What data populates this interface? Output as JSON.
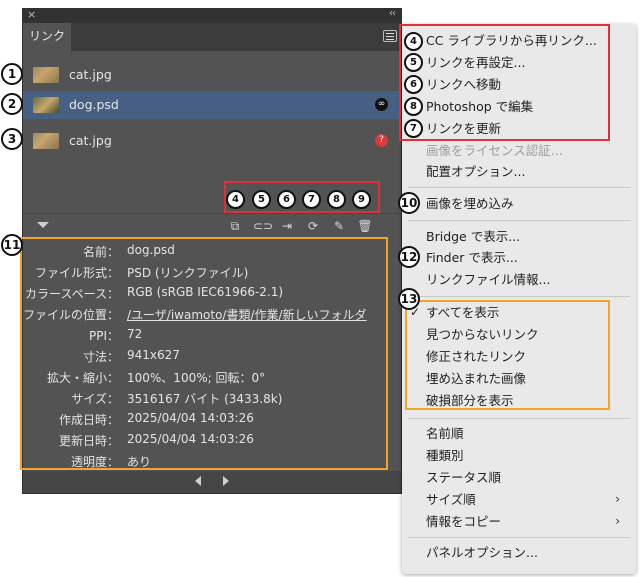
{
  "panel": {
    "close_icon": "×",
    "collapse_icon": "‹‹",
    "tab_label": "リンク",
    "links": [
      {
        "name": "cat.jpg",
        "thumb": "cat",
        "badge": ""
      },
      {
        "name": "dog.psd",
        "thumb": "dog",
        "badge": "link"
      },
      {
        "name": "cat.jpg",
        "thumb": "cat",
        "badge": "missing"
      }
    ],
    "toolbar_icons": [
      "cc-relink-icon",
      "relink-icon",
      "go-to-link-icon",
      "update-link-icon",
      "edit-original-icon",
      "delete-icon"
    ],
    "info": [
      {
        "label": "名前：",
        "value": "dog.psd"
      },
      {
        "label": "ファイル形式：",
        "value": "PSD (リンクファイル)"
      },
      {
        "label": "カラースペース：",
        "value": "RGB (sRGB IEC61966-2.1)"
      },
      {
        "label": "ファイルの位置：",
        "value": "/ユーザ/iwamoto/書類/作業/新しいフォルダ"
      },
      {
        "label": "PPI：",
        "value": "72"
      },
      {
        "label": "寸法：",
        "value": "941x627"
      },
      {
        "label": "拡大・縮小：",
        "value": "100%、100%; 回転：0°"
      },
      {
        "label": "サイズ：",
        "value": "3516167 バイト (3433.8k)"
      },
      {
        "label": "作成日時：",
        "value": "2025/04/04 14:03:26"
      },
      {
        "label": "更新日時：",
        "value": "2025/04/04 14:03:26"
      },
      {
        "label": "透明度：",
        "value": "あり"
      }
    ]
  },
  "menu": {
    "items": [
      {
        "label": "CC ライブラリから再リンク...",
        "state": "enabled"
      },
      {
        "label": "リンクを再設定...",
        "state": "enabled"
      },
      {
        "label": "リンクへ移動",
        "state": "enabled"
      },
      {
        "label": "Photoshop で編集",
        "state": "enabled"
      },
      {
        "label": "リンクを更新",
        "state": "enabled"
      },
      {
        "label": "画像をライセンス認証...",
        "state": "disabled"
      },
      {
        "label": "配置オプション...",
        "state": "enabled"
      },
      {
        "label": "画像を埋め込み",
        "state": "enabled"
      },
      {
        "label": "Bridge で表示...",
        "state": "enabled"
      },
      {
        "label": "Finder で表示...",
        "state": "enabled"
      },
      {
        "label": "リンクファイル情報...",
        "state": "enabled"
      },
      {
        "label": "すべてを表示",
        "state": "checked"
      },
      {
        "label": "見つからないリンク",
        "state": "enabled"
      },
      {
        "label": "修正されたリンク",
        "state": "enabled"
      },
      {
        "label": "埋め込まれた画像",
        "state": "enabled"
      },
      {
        "label": "破損部分を表示",
        "state": "enabled"
      },
      {
        "label": "名前順",
        "state": "enabled"
      },
      {
        "label": "種類別",
        "state": "enabled"
      },
      {
        "label": "ステータス順",
        "state": "enabled"
      },
      {
        "label": "サイズ順",
        "state": "submenu"
      },
      {
        "label": "情報をコピー",
        "state": "submenu"
      },
      {
        "label": "パネルオプション...",
        "state": "enabled"
      }
    ]
  },
  "annotations": [
    "1",
    "2",
    "3",
    "4",
    "5",
    "6",
    "7",
    "8",
    "9",
    "10",
    "11",
    "12",
    "13",
    "4",
    "5",
    "6",
    "8",
    "7"
  ],
  "colors": {
    "red_box": "#e0313b",
    "orange_box": "#f2a52a",
    "selected_row": "#465f82"
  }
}
